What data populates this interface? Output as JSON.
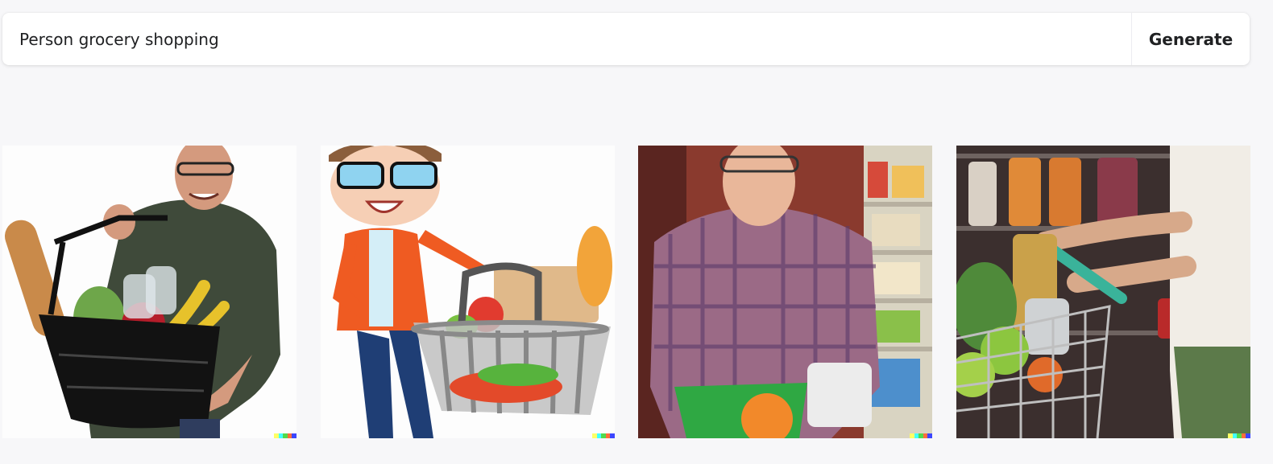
{
  "prompt": {
    "value": "Person grocery shopping",
    "generate_label": "Generate"
  },
  "results": [
    {
      "id": "result-1",
      "style": "photo",
      "subject": "man-with-basket"
    },
    {
      "id": "result-2",
      "style": "cartoon",
      "subject": "cartoon-with-basket"
    },
    {
      "id": "result-3",
      "style": "photo",
      "subject": "man-in-plaid-store"
    },
    {
      "id": "result-4",
      "style": "photo",
      "subject": "cart-closeup"
    }
  ],
  "colors": {
    "page_bg": "#f7f7f9",
    "card_bg": "#ffffff",
    "text": "#202123",
    "watermark": [
      "#ffff66",
      "#42ffff",
      "#51da4c",
      "#ff6e3c",
      "#3c46ff"
    ]
  }
}
